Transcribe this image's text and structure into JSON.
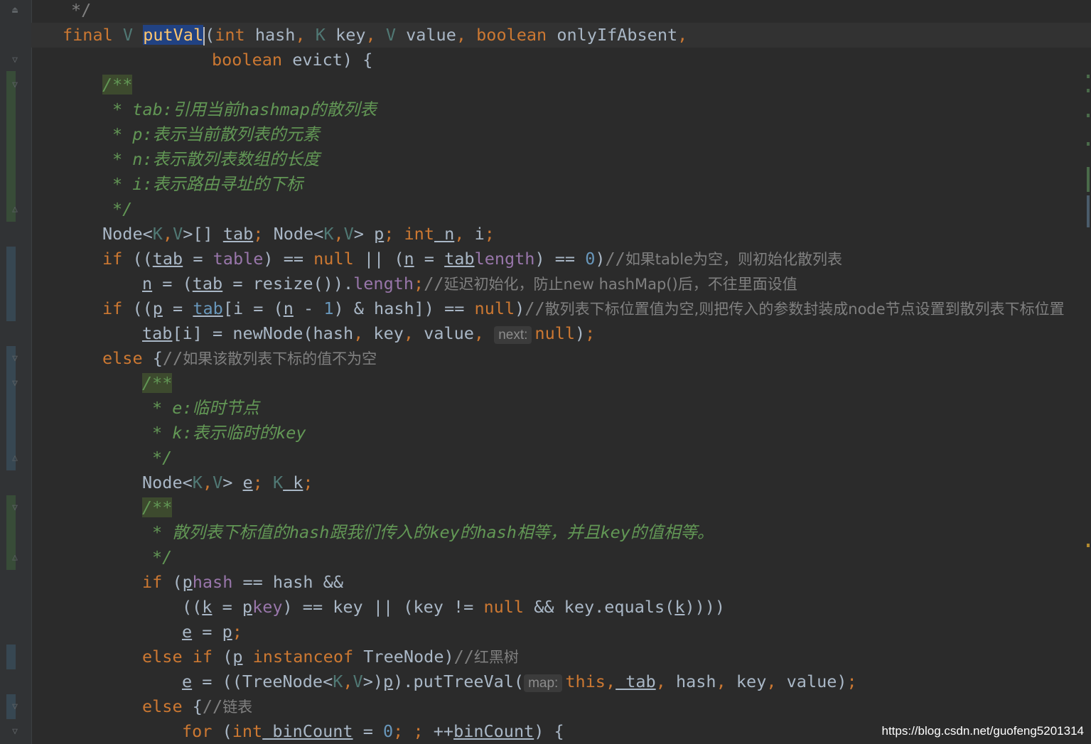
{
  "editor": {
    "language": "java",
    "current_method": "putVal",
    "colors": {
      "background": "#2b2b2b",
      "keyword": "#cc7832",
      "method": "#ffc66d",
      "field": "#9876aa",
      "number": "#6897bb",
      "doc_comment": "#629755",
      "line_comment": "#808080",
      "selection": "#214283"
    }
  },
  "code": {
    "l1": "*/",
    "l2": {
      "final": "final",
      "V": "V",
      "name": "putVal",
      "open": "(",
      "int": "int",
      "hash": " hash",
      "c1": ",",
      "K": " K",
      "key": " key",
      "c2": ",",
      "V2": " V",
      "value": " value",
      "c3": ",",
      "boolean": " boolean",
      "only": " onlyIfAbsent",
      "c4": ","
    },
    "l3": {
      "boolean": "boolean",
      "rest": " evict) {"
    },
    "l4": "/**",
    "l5": {
      "a": "* tab:",
      "b": "引用当前",
      "c": "hashmap",
      "d": "的散列表"
    },
    "l6": {
      "a": "* p:",
      "b": "表示当前散列表的元素"
    },
    "l7": {
      "a": "* n:",
      "b": "表示散列表数组的长度"
    },
    "l8": {
      "a": "* i:",
      "b": "表示路由寻址的下标"
    },
    "l9": "*/",
    "l10": {
      "node": "Node<",
      "K": "K",
      ",": ",",
      "V": "V",
      "arr": ">[] ",
      "tab": "tab",
      "semi": ";",
      "node2": " Node<",
      "K2": "K",
      ",2": ",",
      "V2": "V",
      "gt": "> ",
      "p": "p",
      "semi2": ";",
      "int": " int",
      "n": " n",
      "c": ",",
      "i": " i",
      "semi3": ";"
    },
    "l11": {
      "if": "if",
      "a": " ((",
      "tab": "tab",
      "b": " = ",
      "table": "table",
      "c": ") == ",
      "null": "null",
      "d": " || (",
      "n": "n",
      "e": " = ",
      "tab2": "tab",
      ".": ".",
      "length": "length",
      "f": ") == ",
      "zero": "0",
      "g": ")",
      "cm": "//",
      "cz": "如果table为空，则初始化散列表"
    },
    "l12": {
      "n": "n",
      "a": " = (",
      "tab": "tab",
      "b": " = resize()).",
      "length": "length",
      "semi": ";",
      "cm": "//",
      "cz": "延迟初始化，防止new hashMap()后，不往里面设值"
    },
    "l13": {
      "if": "if",
      "a": " ((",
      "p": "p",
      "b": " = ",
      "tab": "tab",
      "c": "[i = (",
      "n": "n",
      "d": " - ",
      "one": "1",
      "e": ") & hash]) == ",
      "null": "null",
      "f": ")",
      "cm": "//",
      "cz": "散列表下标位置值为空,则把传入的参数封装成node节点设置到散列表下标位置"
    },
    "l14": {
      "tab": "tab",
      "a": "[i] = newNode(hash",
      "c1": ",",
      "b": " key",
      "c2": ",",
      "c": " value",
      "c3": ", ",
      "hint": "next:",
      "null": "null",
      "d": ")",
      "semi": ";"
    },
    "l15": {
      "else": "else",
      "a": " {",
      "cm": "//",
      "cz": "如果该散列表下标的值不为空"
    },
    "l16": "/**",
    "l17": {
      "a": "* e:",
      "b": "临时节点"
    },
    "l18": {
      "a": "* k:",
      "b": "表示临时的",
      "c": "key"
    },
    "l19": "*/",
    "l20": {
      "node": "Node<",
      "K": "K",
      ",": ",",
      "V": "V",
      "gt": "> ",
      "e": "e",
      "semi": ";",
      "K2": " K",
      "k": " k",
      "semi2": ";"
    },
    "l21": "/**",
    "l22": {
      "a": "* ",
      "b": "散列表下标值的",
      "c": "hash",
      "d": "跟我们传入的",
      "e": "key",
      "f": "的",
      "g": "hash",
      "h": "相等，并且",
      "i": "key",
      "j": "的值相等。"
    },
    "l23": "*/",
    "l24": {
      "if": "if",
      "a": " (",
      "p": "p",
      ".": ".",
      "hash": "hash",
      "b": " == hash &&"
    },
    "l25": {
      "a": "((",
      "k": "k",
      "b": " = ",
      "p": "p",
      ".": ".",
      "key": "key",
      "c": ") == key || (key != ",
      "null": "null",
      "d": " && key.equals(",
      "k2": "k",
      "e": "))))"
    },
    "l26": {
      "e": "e",
      "a": " = ",
      "p": "p",
      "semi": ";"
    },
    "l27": {
      "else": "else",
      "if": " if",
      "a": " (",
      "p": "p",
      "inst": " instanceof",
      "b": " TreeNode)",
      "cm": "//",
      "cz": "红黑树"
    },
    "l28": {
      "e": "e",
      "a": " = ((TreeNode<",
      "K": "K",
      ",": ",",
      "V": "V",
      "b": ">)",
      "p": "p",
      "c": ").putTreeVal(",
      "hint": "map:",
      "this": "this",
      ",1": ",",
      "tab": " tab",
      ",2": ",",
      "hash": " hash",
      ",3": ",",
      "key": " key",
      ",4": ",",
      "value": " value",
      "d": ")",
      "semi": ";"
    },
    "l29": {
      "else": "else",
      "a": " {",
      "cm": "//",
      "cz": "链表"
    },
    "l30": {
      "for": "for",
      "a": " (",
      "int": "int",
      "bc": " binCount",
      "b": " = ",
      "zero": "0",
      "s1": ";",
      "s2": " ;",
      "c": " ++",
      "bc2": "binCount",
      "d": ") {"
    }
  },
  "watermark": "https://blog.csdn.net/guofeng5201314"
}
